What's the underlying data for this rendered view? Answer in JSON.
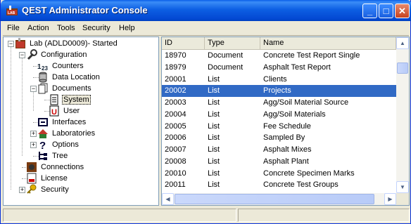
{
  "window": {
    "title": "QEST Administrator Console"
  },
  "titlebar_buttons": {
    "minimize": "_",
    "maximize": "□",
    "close": "✕"
  },
  "menu": [
    "File",
    "Action",
    "Tools",
    "Security",
    "Help"
  ],
  "tree": [
    {
      "label": "Lab (ADLD0009)- Started",
      "icon": "lab-icon",
      "level": 0,
      "expander": "−"
    },
    {
      "label": "Configuration",
      "icon": "wrench-icon",
      "level": 1,
      "expander": "−"
    },
    {
      "label": "Counters",
      "icon": "counters-icon",
      "level": 2,
      "expander": ""
    },
    {
      "label": "Data Location",
      "icon": "database-icon",
      "level": 2,
      "expander": ""
    },
    {
      "label": "Documents",
      "icon": "documents-icon",
      "level": 2,
      "expander": "−"
    },
    {
      "label": "System",
      "icon": "system-document-icon",
      "level": 3,
      "expander": "",
      "selected": true
    },
    {
      "label": "User",
      "icon": "user-document-icon",
      "level": 3,
      "expander": ""
    },
    {
      "label": "Interfaces",
      "icon": "interfaces-icon",
      "level": 2,
      "expander": ""
    },
    {
      "label": "Laboratories",
      "icon": "laboratories-icon",
      "level": 2,
      "expander": "+"
    },
    {
      "label": "Options",
      "icon": "question-icon",
      "level": 2,
      "expander": "+"
    },
    {
      "label": "Tree",
      "icon": "tree-icon",
      "level": 2,
      "expander": ""
    },
    {
      "label": "Connections",
      "icon": "connections-icon",
      "level": 1,
      "expander": ""
    },
    {
      "label": "License",
      "icon": "license-icon",
      "level": 1,
      "expander": ""
    },
    {
      "label": "Security",
      "icon": "key-icon",
      "level": 1,
      "expander": "+"
    }
  ],
  "list": {
    "columns": [
      "ID",
      "Type",
      "Name"
    ],
    "rows": [
      {
        "id": "18970",
        "type": "Document",
        "name": "Concrete Test Report Single"
      },
      {
        "id": "18979",
        "type": "Document",
        "name": "Asphalt Test Report"
      },
      {
        "id": "20001",
        "type": "List",
        "name": "Clients"
      },
      {
        "id": "20002",
        "type": "List",
        "name": "Projects",
        "selected": true
      },
      {
        "id": "20003",
        "type": "List",
        "name": "Agg/Soil Material Source"
      },
      {
        "id": "20004",
        "type": "List",
        "name": "Agg/Soil Materials"
      },
      {
        "id": "20005",
        "type": "List",
        "name": "Fee Schedule"
      },
      {
        "id": "20006",
        "type": "List",
        "name": "Sampled By"
      },
      {
        "id": "20007",
        "type": "List",
        "name": "Asphalt Mixes"
      },
      {
        "id": "20008",
        "type": "List",
        "name": "Asphalt Plant"
      },
      {
        "id": "20010",
        "type": "List",
        "name": "Concrete Specimen Marks"
      },
      {
        "id": "20011",
        "type": "List",
        "name": "Concrete Test Groups"
      }
    ]
  },
  "scrollbar_glyphs": {
    "up": "▲",
    "down": "▼",
    "left": "◀",
    "right": "▶"
  }
}
